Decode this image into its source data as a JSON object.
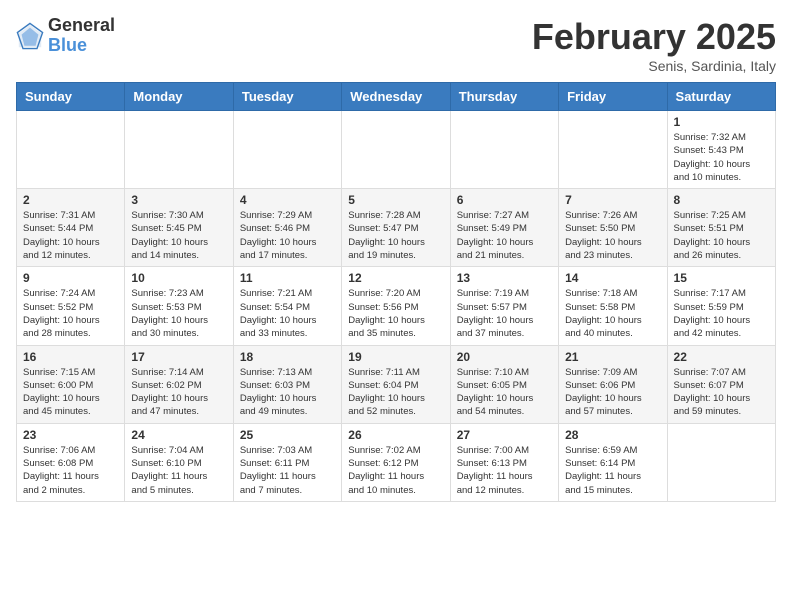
{
  "header": {
    "logo_general": "General",
    "logo_blue": "Blue",
    "title": "February 2025",
    "subtitle": "Senis, Sardinia, Italy"
  },
  "weekdays": [
    "Sunday",
    "Monday",
    "Tuesday",
    "Wednesday",
    "Thursday",
    "Friday",
    "Saturday"
  ],
  "weeks": [
    [
      {
        "day": "",
        "info": ""
      },
      {
        "day": "",
        "info": ""
      },
      {
        "day": "",
        "info": ""
      },
      {
        "day": "",
        "info": ""
      },
      {
        "day": "",
        "info": ""
      },
      {
        "day": "",
        "info": ""
      },
      {
        "day": "1",
        "info": "Sunrise: 7:32 AM\nSunset: 5:43 PM\nDaylight: 10 hours\nand 10 minutes."
      }
    ],
    [
      {
        "day": "2",
        "info": "Sunrise: 7:31 AM\nSunset: 5:44 PM\nDaylight: 10 hours\nand 12 minutes."
      },
      {
        "day": "3",
        "info": "Sunrise: 7:30 AM\nSunset: 5:45 PM\nDaylight: 10 hours\nand 14 minutes."
      },
      {
        "day": "4",
        "info": "Sunrise: 7:29 AM\nSunset: 5:46 PM\nDaylight: 10 hours\nand 17 minutes."
      },
      {
        "day": "5",
        "info": "Sunrise: 7:28 AM\nSunset: 5:47 PM\nDaylight: 10 hours\nand 19 minutes."
      },
      {
        "day": "6",
        "info": "Sunrise: 7:27 AM\nSunset: 5:49 PM\nDaylight: 10 hours\nand 21 minutes."
      },
      {
        "day": "7",
        "info": "Sunrise: 7:26 AM\nSunset: 5:50 PM\nDaylight: 10 hours\nand 23 minutes."
      },
      {
        "day": "8",
        "info": "Sunrise: 7:25 AM\nSunset: 5:51 PM\nDaylight: 10 hours\nand 26 minutes."
      }
    ],
    [
      {
        "day": "9",
        "info": "Sunrise: 7:24 AM\nSunset: 5:52 PM\nDaylight: 10 hours\nand 28 minutes."
      },
      {
        "day": "10",
        "info": "Sunrise: 7:23 AM\nSunset: 5:53 PM\nDaylight: 10 hours\nand 30 minutes."
      },
      {
        "day": "11",
        "info": "Sunrise: 7:21 AM\nSunset: 5:54 PM\nDaylight: 10 hours\nand 33 minutes."
      },
      {
        "day": "12",
        "info": "Sunrise: 7:20 AM\nSunset: 5:56 PM\nDaylight: 10 hours\nand 35 minutes."
      },
      {
        "day": "13",
        "info": "Sunrise: 7:19 AM\nSunset: 5:57 PM\nDaylight: 10 hours\nand 37 minutes."
      },
      {
        "day": "14",
        "info": "Sunrise: 7:18 AM\nSunset: 5:58 PM\nDaylight: 10 hours\nand 40 minutes."
      },
      {
        "day": "15",
        "info": "Sunrise: 7:17 AM\nSunset: 5:59 PM\nDaylight: 10 hours\nand 42 minutes."
      }
    ],
    [
      {
        "day": "16",
        "info": "Sunrise: 7:15 AM\nSunset: 6:00 PM\nDaylight: 10 hours\nand 45 minutes."
      },
      {
        "day": "17",
        "info": "Sunrise: 7:14 AM\nSunset: 6:02 PM\nDaylight: 10 hours\nand 47 minutes."
      },
      {
        "day": "18",
        "info": "Sunrise: 7:13 AM\nSunset: 6:03 PM\nDaylight: 10 hours\nand 49 minutes."
      },
      {
        "day": "19",
        "info": "Sunrise: 7:11 AM\nSunset: 6:04 PM\nDaylight: 10 hours\nand 52 minutes."
      },
      {
        "day": "20",
        "info": "Sunrise: 7:10 AM\nSunset: 6:05 PM\nDaylight: 10 hours\nand 54 minutes."
      },
      {
        "day": "21",
        "info": "Sunrise: 7:09 AM\nSunset: 6:06 PM\nDaylight: 10 hours\nand 57 minutes."
      },
      {
        "day": "22",
        "info": "Sunrise: 7:07 AM\nSunset: 6:07 PM\nDaylight: 10 hours\nand 59 minutes."
      }
    ],
    [
      {
        "day": "23",
        "info": "Sunrise: 7:06 AM\nSunset: 6:08 PM\nDaylight: 11 hours\nand 2 minutes."
      },
      {
        "day": "24",
        "info": "Sunrise: 7:04 AM\nSunset: 6:10 PM\nDaylight: 11 hours\nand 5 minutes."
      },
      {
        "day": "25",
        "info": "Sunrise: 7:03 AM\nSunset: 6:11 PM\nDaylight: 11 hours\nand 7 minutes."
      },
      {
        "day": "26",
        "info": "Sunrise: 7:02 AM\nSunset: 6:12 PM\nDaylight: 11 hours\nand 10 minutes."
      },
      {
        "day": "27",
        "info": "Sunrise: 7:00 AM\nSunset: 6:13 PM\nDaylight: 11 hours\nand 12 minutes."
      },
      {
        "day": "28",
        "info": "Sunrise: 6:59 AM\nSunset: 6:14 PM\nDaylight: 11 hours\nand 15 minutes."
      },
      {
        "day": "",
        "info": ""
      }
    ]
  ]
}
